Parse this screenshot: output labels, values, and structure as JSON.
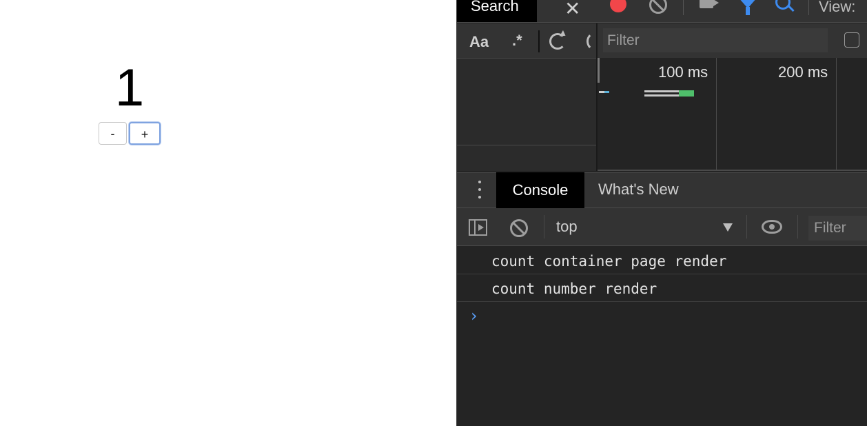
{
  "page": {
    "count": "1",
    "decrement_label": "-",
    "increment_label": "+"
  },
  "devtools": {
    "top_tab": "Search",
    "view_label": "View:",
    "search": {
      "match_case_label": "Aa",
      "regex_label": ".*",
      "filter_placeholder": "Filter"
    },
    "timeline": {
      "ticks": [
        "100 ms",
        "200 ms"
      ]
    },
    "drawer": {
      "tabs": [
        "Console",
        "What's New"
      ],
      "context": "top",
      "filter_placeholder": "Filter"
    },
    "console_logs": [
      "count container page render",
      "count number render"
    ],
    "prompt": "›"
  },
  "colors": {
    "record": "#f2464a",
    "accent": "#3d8bf0",
    "panel_bg": "#242424",
    "toolbar_bg": "#333333"
  }
}
